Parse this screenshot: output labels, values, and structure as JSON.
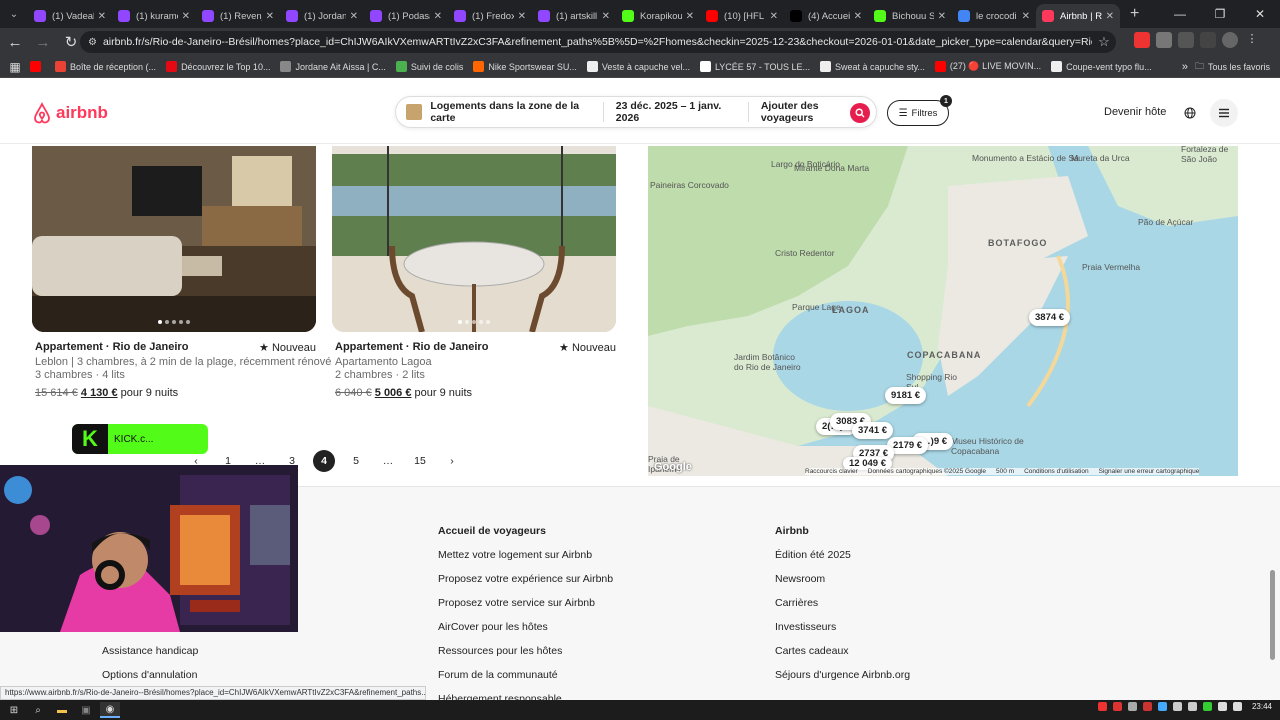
{
  "browser": {
    "tabs": [
      {
        "label": "(1) Vadeal",
        "color": "#9146ff"
      },
      {
        "label": "(1) kuramo",
        "color": "#9146ff"
      },
      {
        "label": "(1) Revenj",
        "color": "#9146ff"
      },
      {
        "label": "(1) Jordan",
        "color": "#9146ff"
      },
      {
        "label": "(1) Podasa",
        "color": "#9146ff"
      },
      {
        "label": "(1) Fredox",
        "color": "#9146ff"
      },
      {
        "label": "(1) artskill",
        "color": "#9146ff"
      },
      {
        "label": "Korapikou",
        "color": "#53fc18"
      },
      {
        "label": "(10) [HFL",
        "color": "#ff0000"
      },
      {
        "label": "(4) Accueil",
        "color": "#000000"
      },
      {
        "label": "Bichouu S",
        "color": "#53fc18"
      },
      {
        "label": "le crocodi",
        "color": "#4285f4"
      },
      {
        "label": "Airbnb | R",
        "color": "#ff385c",
        "active": true
      }
    ],
    "url": "airbnb.fr/s/Rio-de-Janeiro--Brésil/homes?place_id=ChIJW6AIkVXemwARTtIvZ2xC3FA&refinement_paths%5B%5D=%2Fhomes&checkin=2025-12-23&checkout=2026-01-01&date_picker_type=calendar&query=Rio%20de%20Janeiro%2C...",
    "bookmarks": [
      {
        "label": "",
        "color": "#ff0000"
      },
      {
        "label": "Boîte de réception (...",
        "color": "#ea4335"
      },
      {
        "label": "Découvrez le Top 10...",
        "color": "#e50914"
      },
      {
        "label": "Jordane Ait Aissa | C...",
        "color": "#888888"
      },
      {
        "label": "Suivi de colis",
        "color": "#4caf50"
      },
      {
        "label": "Nike Sportswear SU...",
        "color": "#ff6600"
      },
      {
        "label": "Veste à capuche vel...",
        "color": "#eeeeee"
      },
      {
        "label": "LYCÉE 57 - TOUS LE...",
        "color": "#ffffff"
      },
      {
        "label": "Sweat à capuche sty...",
        "color": "#eeeeee"
      },
      {
        "label": "(27) 🔴 LIVE MOVIN...",
        "color": "#ff0000"
      },
      {
        "label": "Coupe-vent typo flu...",
        "color": "#eeeeee"
      }
    ],
    "bookmarks_all": "Tous les favoris",
    "status_url": "https://www.airbnb.fr/s/Rio-de-Janeiro--Brésil/homes?place_id=ChIJW6AIkVXemwARTtIvZ2xC3FA&refinement_paths..."
  },
  "header": {
    "logo": "airbnb",
    "search_location": "Logements dans la zone de la carte",
    "search_dates": "23 déc. 2025 – 1 janv. 2026",
    "search_guests": "Ajouter des voyageurs",
    "filters_label": "Filtres",
    "filters_count": "1",
    "host_link": "Devenir hôte"
  },
  "listings": [
    {
      "title": "Appartement · Rio de Janeiro",
      "badge": "Nouveau",
      "desc": "Leblon | 3 chambres, à 2 min de la plage, récemment rénové",
      "rooms": "3 chambres · 4 lits",
      "old_price": "15 614 €",
      "new_price": "4 130 €",
      "price_suffix": "pour 9 nuits"
    },
    {
      "title": "Appartement · Rio de Janeiro",
      "badge": "Nouveau",
      "desc": "Apartamento Lagoa",
      "rooms": "2 chambres · 2 lits",
      "old_price": "6 040 €",
      "new_price": "5 006 €",
      "price_suffix": "pour 9 nuits"
    }
  ],
  "pagination": {
    "pages": [
      "1",
      "…",
      "3",
      "4",
      "5",
      "…",
      "15"
    ],
    "current": "4"
  },
  "map": {
    "labels": [
      "Largo do Boticário",
      "Mirante Dona Marta",
      "Paineiras Corcovado",
      "Cristo Redentor",
      "Monumento a Estácio de Sá",
      "Mureta da Urca",
      "Pão de Açúcar",
      "Praia Vermelha",
      "BOTAFOGO",
      "LAGOA",
      "Parque Lage",
      "COPACABANA",
      "Jardim Botânico do Rio de Janeiro",
      "Museu Histórico de Copacabana",
      "Fortaleza de São João",
      "Praia de Ipanema",
      "Shopping Rio Sul"
    ],
    "prices": [
      "3874 €",
      "9181 €",
      "3083 €",
      "3741 €",
      "2179 €",
      "2737 €",
      "12 049 €",
      "2(…) €",
      "(…)9 €"
    ],
    "footer": [
      "Raccourcis clavier",
      "Données cartographiques ©2025 Google",
      "500 m",
      "Conditions d'utilisation",
      "Signaler une erreur cartographique"
    ],
    "google": "Google"
  },
  "footer": {
    "col1_head": "Accueil de voyageurs",
    "col1": [
      "Mettez votre logement sur Airbnb",
      "Proposez votre expérience sur Airbnb",
      "Proposez votre service sur Airbnb",
      "AirCover pour les hôtes",
      "Ressources pour les hôtes",
      "Forum de la communauté",
      "Hébergement responsable"
    ],
    "col2_head": "Airbnb",
    "col2": [
      "Édition été 2025",
      "Newsroom",
      "Carrières",
      "Investisseurs",
      "Cartes cadeaux",
      "Séjours d'urgence Airbnb.org"
    ],
    "col0": [
      "Assistance handicap",
      "Options d'annulation"
    ]
  },
  "overlay": {
    "kick_text": "KICK.c..."
  },
  "taskbar": {
    "clock": "23:44"
  }
}
